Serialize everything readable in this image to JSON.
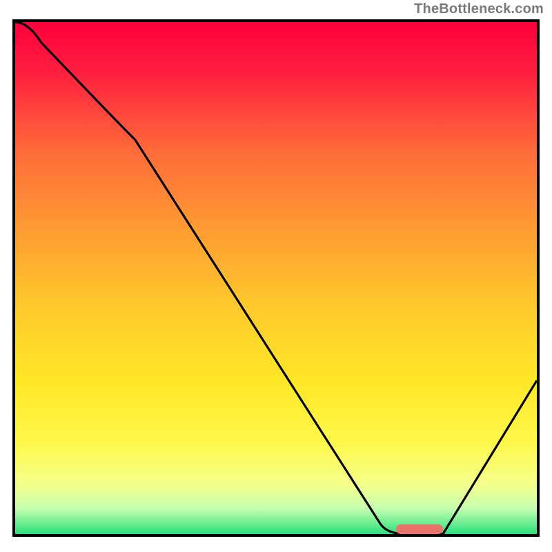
{
  "watermark": "TheBottleneck.com",
  "chart_data": {
    "type": "line",
    "title": "",
    "xlabel": "",
    "ylabel": "",
    "xlim": [
      0,
      100
    ],
    "ylim": [
      0,
      100
    ],
    "x": [
      0,
      5,
      23,
      70,
      75,
      82,
      100
    ],
    "values": [
      100,
      96,
      77,
      2,
      0,
      0,
      30
    ],
    "curve_description": "Black V-shaped curve starting at top-left, descending with slight convex break around x≈23, bottoming out near x≈75-82, then rising to x=100 at y≈30",
    "background_gradient": {
      "direction": "top-to-bottom",
      "stops": [
        {
          "pos": 0.0,
          "color": "#ff003c"
        },
        {
          "pos": 0.1,
          "color": "#ff1f3f"
        },
        {
          "pos": 0.25,
          "color": "#ff6a3a"
        },
        {
          "pos": 0.4,
          "color": "#ff9a33"
        },
        {
          "pos": 0.55,
          "color": "#ffc82d"
        },
        {
          "pos": 0.7,
          "color": "#ffe727"
        },
        {
          "pos": 0.82,
          "color": "#fff84a"
        },
        {
          "pos": 0.9,
          "color": "#f6ff8a"
        },
        {
          "pos": 0.95,
          "color": "#c7ffb0"
        },
        {
          "pos": 1.0,
          "color": "#29e07b"
        }
      ]
    },
    "marker": {
      "x_start": 73,
      "x_end": 82,
      "y": 0.5,
      "color": "#e8736b",
      "shape": "rounded-bar"
    }
  }
}
